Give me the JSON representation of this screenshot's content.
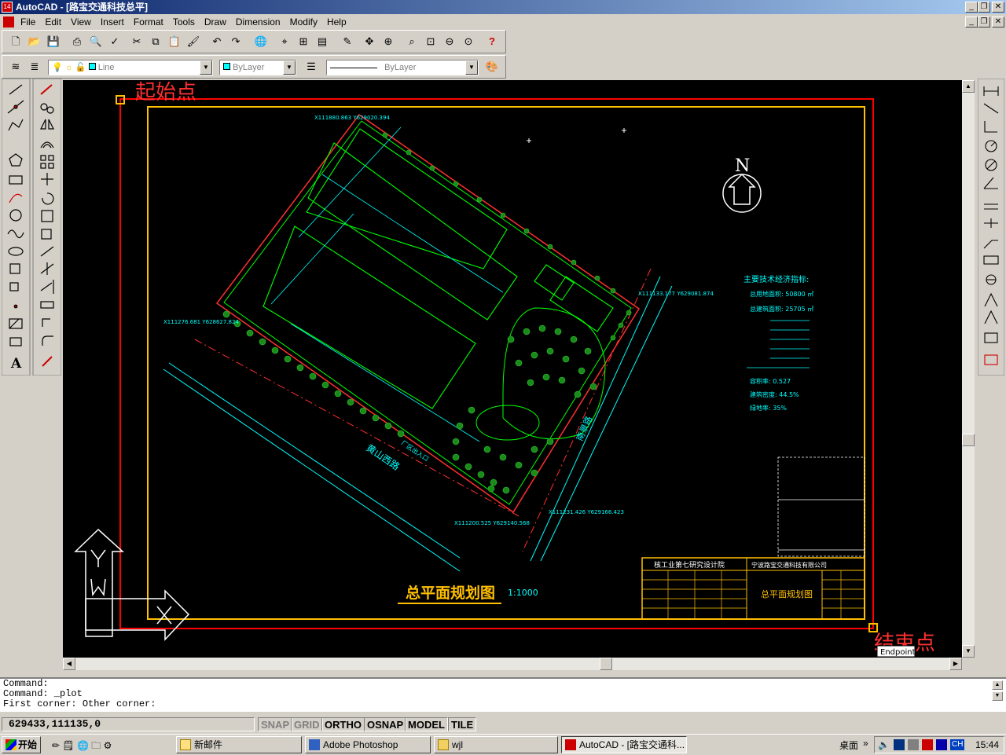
{
  "window": {
    "title": "AutoCAD - [路宝交通科技总平]",
    "app_icon_label": "14"
  },
  "menu": [
    "File",
    "Edit",
    "View",
    "Insert",
    "Format",
    "Tools",
    "Draw",
    "Dimension",
    "Modify",
    "Help"
  ],
  "properties_bar": {
    "layer_value": "Line",
    "color_value": "ByLayer",
    "linetype_value": "ByLayer"
  },
  "drawing": {
    "start_label": "起始点",
    "end_label": "结束点",
    "snap_tooltip": "Endpoint",
    "north_label": "N",
    "plan_title": "总平面规划图",
    "scale": "1:1000",
    "road_label": "黄山西路",
    "east_road_label": "南景路",
    "gate_label": "厂区出入口",
    "indicators_title": "主要技术经济指标:",
    "indicators": [
      "总用地面积: 50800 ㎡",
      "总建筑面积: 25705 ㎡",
      "容积率: 0.527",
      "建筑密度: 44.5%",
      "绿地率: 35%"
    ],
    "title_block": {
      "designer_org": "核工业第七研究设计院",
      "client": "宁波路宝交通科技有限公司",
      "drawing_name": "总平面规划图"
    },
    "coord_labels": [
      "X111880.863 Y629020.394",
      "X111276.681 Y628627.824",
      "X111133.177 Y629081.874",
      "X111231.426 Y629166.423",
      "X111200.525 Y629140.568"
    ]
  },
  "command_line": {
    "lines": [
      "Command:",
      "Command: _plot",
      "First corner: Other corner:"
    ]
  },
  "status": {
    "coords": "629433,111135,0",
    "toggles": [
      {
        "label": "SNAP",
        "on": false
      },
      {
        "label": "GRID",
        "on": false
      },
      {
        "label": "ORTHO",
        "on": true
      },
      {
        "label": "OSNAP",
        "on": true
      },
      {
        "label": "MODEL",
        "on": true
      },
      {
        "label": "TILE",
        "on": true
      }
    ]
  },
  "taskbar": {
    "start": "开始",
    "tasks": [
      "新邮件",
      "Adobe Photoshop",
      "wjl",
      "AutoCAD - [路宝交通科..."
    ],
    "desktop": "桌面",
    "lang": "CH",
    "time": "15:44"
  },
  "colors": {
    "canvas": "#000000",
    "plot_window": "#ff0000",
    "sheet_border": "#ffc000",
    "cyan": "#00ffff",
    "green": "#00ff00",
    "tree": "#1a8a1a",
    "label_red": "#ff3030",
    "title_bar_start": "#0a246a"
  }
}
